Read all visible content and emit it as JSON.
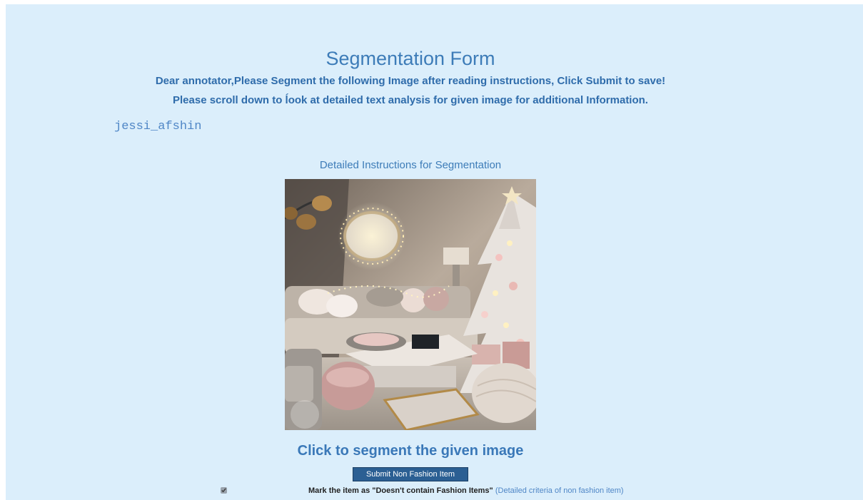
{
  "form": {
    "title": "Segmentation Form",
    "greeting": "Dear annotator,Please Segment the following Image after reading instructions, Click Submit to save!",
    "scroll_note": "Please scroll down to ĺook at detailed text analysis for given image for additional Information.",
    "username": "jessi_afshin",
    "instructions_link": "Detailed Instructions for Segmentation",
    "image_alt": "living room with christmas tree",
    "segment_link": "Click to segment the given image",
    "submit_button": "Submit Non Fashion Item",
    "mark_label": "Mark the item as \"Doesn't contain Fashion Items\"",
    "criteria_link": "(Detailed criteria of non fashion item)",
    "mark_checked": true
  },
  "colors": {
    "background": "#dbeefb",
    "heading": "#3d7cb8",
    "button": "#2b5f93"
  }
}
